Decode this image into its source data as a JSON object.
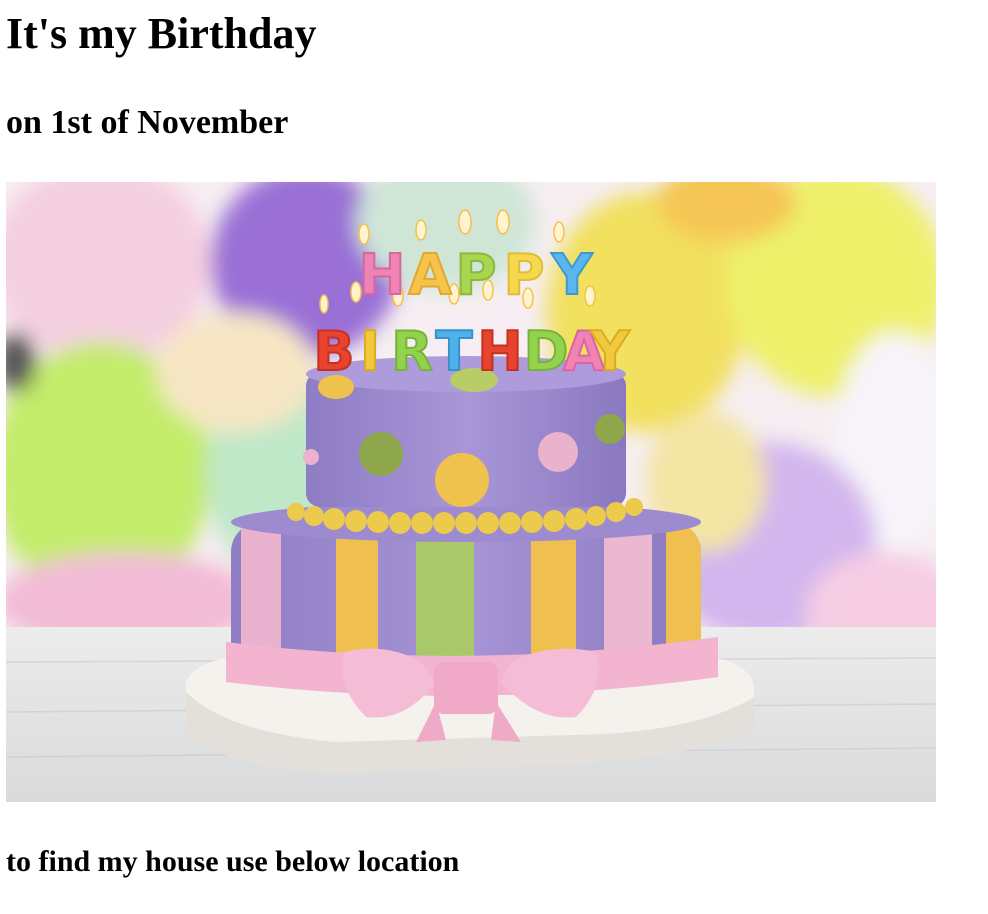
{
  "page": {
    "heading": "It's my Birthday",
    "subheading": "on 1st of November",
    "location_text": "to find my house use below location"
  },
  "image": {
    "subject": "birthday-cake-photo",
    "candle_letters_top": [
      "H",
      "A",
      "P",
      "P",
      "Y"
    ],
    "candle_letters_bottom": [
      "B",
      "I",
      "R",
      "T",
      "H",
      "D",
      "A",
      "Y"
    ]
  }
}
